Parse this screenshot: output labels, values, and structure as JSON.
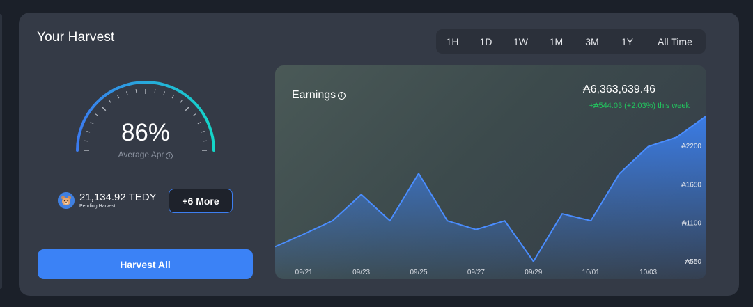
{
  "card": {
    "title": "Your Harvest"
  },
  "ranges": [
    {
      "label": "1H",
      "width": 47
    },
    {
      "label": "1D",
      "width": 49
    },
    {
      "label": "1W",
      "width": 51
    },
    {
      "label": "1M",
      "width": 51
    },
    {
      "label": "3M",
      "width": 52
    },
    {
      "label": "1Y",
      "width": 49
    },
    {
      "label": "All Time",
      "width": 88
    }
  ],
  "gauge": {
    "value": "86%",
    "label": "Average Apr",
    "percent": 86
  },
  "pending": {
    "amount": "21,134.92 TEDY",
    "label": "Pending Harvest"
  },
  "buttons": {
    "more": "+6 More",
    "harvest_all": "Harvest All"
  },
  "earnings": {
    "title": "Earnings",
    "total": "₳6,363,639.46",
    "change": "+₳544.03 (+2.03%) this week"
  },
  "colors": {
    "accent": "#3b82f6",
    "positive": "#22c55e",
    "gauge_end": "#14d6c8"
  },
  "chart_data": {
    "type": "area",
    "x": [
      "09/20",
      "09/21",
      "09/22",
      "09/23",
      "09/24",
      "09/25",
      "09/26",
      "09/27",
      "09/28",
      "09/29",
      "09/30",
      "10/01",
      "10/02",
      "10/03",
      "10/04",
      "10/05"
    ],
    "xticks": [
      "09/21",
      "09/23",
      "09/25",
      "09/27",
      "09/29",
      "10/01",
      "10/03"
    ],
    "yticks": [
      "₳550",
      "₳1100",
      "₳1650",
      "₳2200"
    ],
    "ytick_values": [
      550,
      1100,
      1650,
      2200
    ],
    "ylim": [
      0,
      2400
    ],
    "values": [
      765,
      945,
      1135,
      1510,
      1135,
      1810,
      1135,
      1010,
      1135,
      555,
      1235,
      1135,
      1810,
      2195,
      2330,
      2625
    ]
  }
}
